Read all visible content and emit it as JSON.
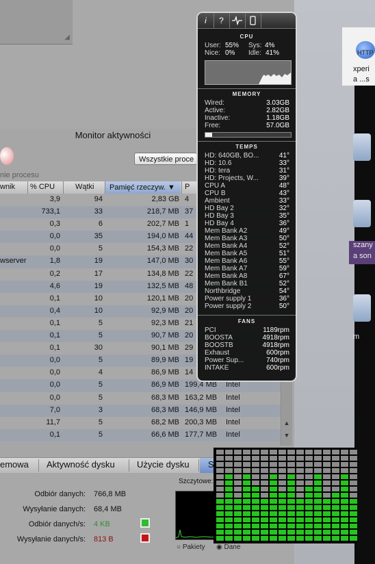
{
  "activity_monitor": {
    "title": "Monitor aktywności",
    "filter_select": "Wszystkie proce",
    "process_label": "nie procesu",
    "columns": [
      "wnik",
      "% CPU",
      "Wątki",
      "Pamięć rzeczyw. ▼",
      "P"
    ],
    "rows": [
      [
        "",
        "3,9",
        "94",
        "2,83 GB",
        "4"
      ],
      [
        "",
        "733,1",
        "33",
        "218,7 MB",
        "37"
      ],
      [
        "",
        "0,3",
        "6",
        "202,7 MB",
        "1"
      ],
      [
        "",
        "0,0",
        "35",
        "194,0 MB",
        "44"
      ],
      [
        "",
        "0,0",
        "5",
        "154,3 MB",
        "22"
      ],
      [
        "wserver",
        "1,8",
        "19",
        "147,0 MB",
        "30"
      ],
      [
        "",
        "0,2",
        "17",
        "134,8 MB",
        "22"
      ],
      [
        "",
        "4,6",
        "19",
        "132,5 MB",
        "48"
      ],
      [
        "",
        "0,1",
        "10",
        "120,1 MB",
        "20"
      ],
      [
        "",
        "0,4",
        "10",
        "92,9 MB",
        "20"
      ],
      [
        "",
        "0,1",
        "5",
        "92,3 MB",
        "21"
      ],
      [
        "",
        "0,1",
        "5",
        "90,7 MB",
        "20"
      ],
      [
        "",
        "0,1",
        "30",
        "90,1 MB",
        "29"
      ],
      [
        "",
        "0,0",
        "5",
        "89,9 MB",
        "19"
      ],
      [
        "",
        "0,0",
        "4",
        "86,9 MB",
        "14"
      ],
      [
        "",
        "0,0",
        "5",
        "86,9 MB",
        "199,4 MB",
        "Intel"
      ],
      [
        "",
        "0,0",
        "5",
        "68,3 MB",
        "163,2 MB",
        "Intel"
      ],
      [
        "",
        "7,0",
        "3",
        "68,3 MB",
        "146,9 MB",
        "Intel"
      ],
      [
        "",
        "11,7",
        "5",
        "68,2 MB",
        "200,3 MB",
        "Intel"
      ],
      [
        "",
        "0,1",
        "5",
        "66,6 MB",
        "177,7 MB",
        "Intel"
      ]
    ],
    "tabs": [
      "emowa",
      "Aktywność dysku",
      "Użycie dysku",
      "S"
    ],
    "network": {
      "peak_label": "Szczytowe:",
      "received_label": "Odbiór danych:",
      "received_value": "766,8 MB",
      "sent_label": "Wysyłanie danych:",
      "sent_value": "68,4 MB",
      "received_rate_label": "Odbiór danych/s:",
      "received_rate_value": "4 KB",
      "sent_rate_label": "Wysyłanie danych/s:",
      "sent_rate_value": "813 B",
      "radio_packets": "Pakiety",
      "radio_data": "Dane"
    }
  },
  "desktop": {
    "http_label": "HTTP",
    "text_1": "xperi",
    "text_2": "a ...s",
    "text_3": "szany",
    "text_4": "a son",
    "text_5": "m"
  },
  "istat": {
    "toolbar_buttons": [
      "i",
      "?",
      "pulse-icon",
      "phone-icon"
    ],
    "cpu": {
      "title": "CPU",
      "user_label": "User:",
      "user_value": "55%",
      "sys_label": "Sys:",
      "sys_value": "4%",
      "nice_label": "Nice:",
      "nice_value": "0%",
      "idle_label": "Idle:",
      "idle_value": "41%"
    },
    "memory": {
      "title": "MEMORY",
      "items": [
        {
          "label": "Wired:",
          "value": "3.03GB"
        },
        {
          "label": "Active:",
          "value": "2.82GB"
        },
        {
          "label": "Inactive:",
          "value": "1.18GB"
        },
        {
          "label": "Free:",
          "value": "57.0GB"
        }
      ],
      "used_fraction": 0.08
    },
    "temps": {
      "title": "TEMPS",
      "items": [
        {
          "label": "HD: 640GB, BO...",
          "value": "41°"
        },
        {
          "label": "HD: 10.6",
          "value": "33°"
        },
        {
          "label": "HD: tera",
          "value": "31°"
        },
        {
          "label": "HD: Projects, W...",
          "value": "39°"
        },
        {
          "label": "CPU A",
          "value": "48°"
        },
        {
          "label": "CPU B",
          "value": "43°"
        },
        {
          "label": "Ambient",
          "value": "33°"
        },
        {
          "label": "HD Bay 2",
          "value": "32°"
        },
        {
          "label": "HD Bay 3",
          "value": "35°"
        },
        {
          "label": "HD Bay 4",
          "value": "36°"
        },
        {
          "label": "Mem Bank A2",
          "value": "49°"
        },
        {
          "label": "Mem Bank A3",
          "value": "50°"
        },
        {
          "label": "Mem Bank A4",
          "value": "52°"
        },
        {
          "label": "Mem Bank A5",
          "value": "51°"
        },
        {
          "label": "Mem Bank A6",
          "value": "55°"
        },
        {
          "label": "Mem Bank A7",
          "value": "59°"
        },
        {
          "label": "Mem Bank A8",
          "value": "67°"
        },
        {
          "label": "Mem Bank B1",
          "value": "52°"
        },
        {
          "label": "Northbridge",
          "value": "54°"
        },
        {
          "label": "Power supply 1",
          "value": "36°"
        },
        {
          "label": "Power supply 2",
          "value": "50°"
        }
      ]
    },
    "fans": {
      "title": "FANS",
      "items": [
        {
          "label": "PCI",
          "value": "1189rpm"
        },
        {
          "label": "BOOSTA",
          "value": "4918rpm"
        },
        {
          "label": "BOOSTB",
          "value": "4918rpm"
        },
        {
          "label": "Exhaust",
          "value": "600rpm"
        },
        {
          "label": "Power Sup...",
          "value": "740rpm"
        },
        {
          "label": "INTAKE",
          "value": "600rpm"
        }
      ]
    }
  },
  "cpu_cores": {
    "levels": [
      0.45,
      0.7,
      0.45,
      0.75,
      0.6,
      0.45,
      0.7,
      0.55,
      0.75,
      0.45,
      0.6,
      0.7,
      0.45,
      0.55,
      0.75,
      0.45
    ],
    "active_color": "#27c41f",
    "idle_color": "#8c8c8c"
  }
}
